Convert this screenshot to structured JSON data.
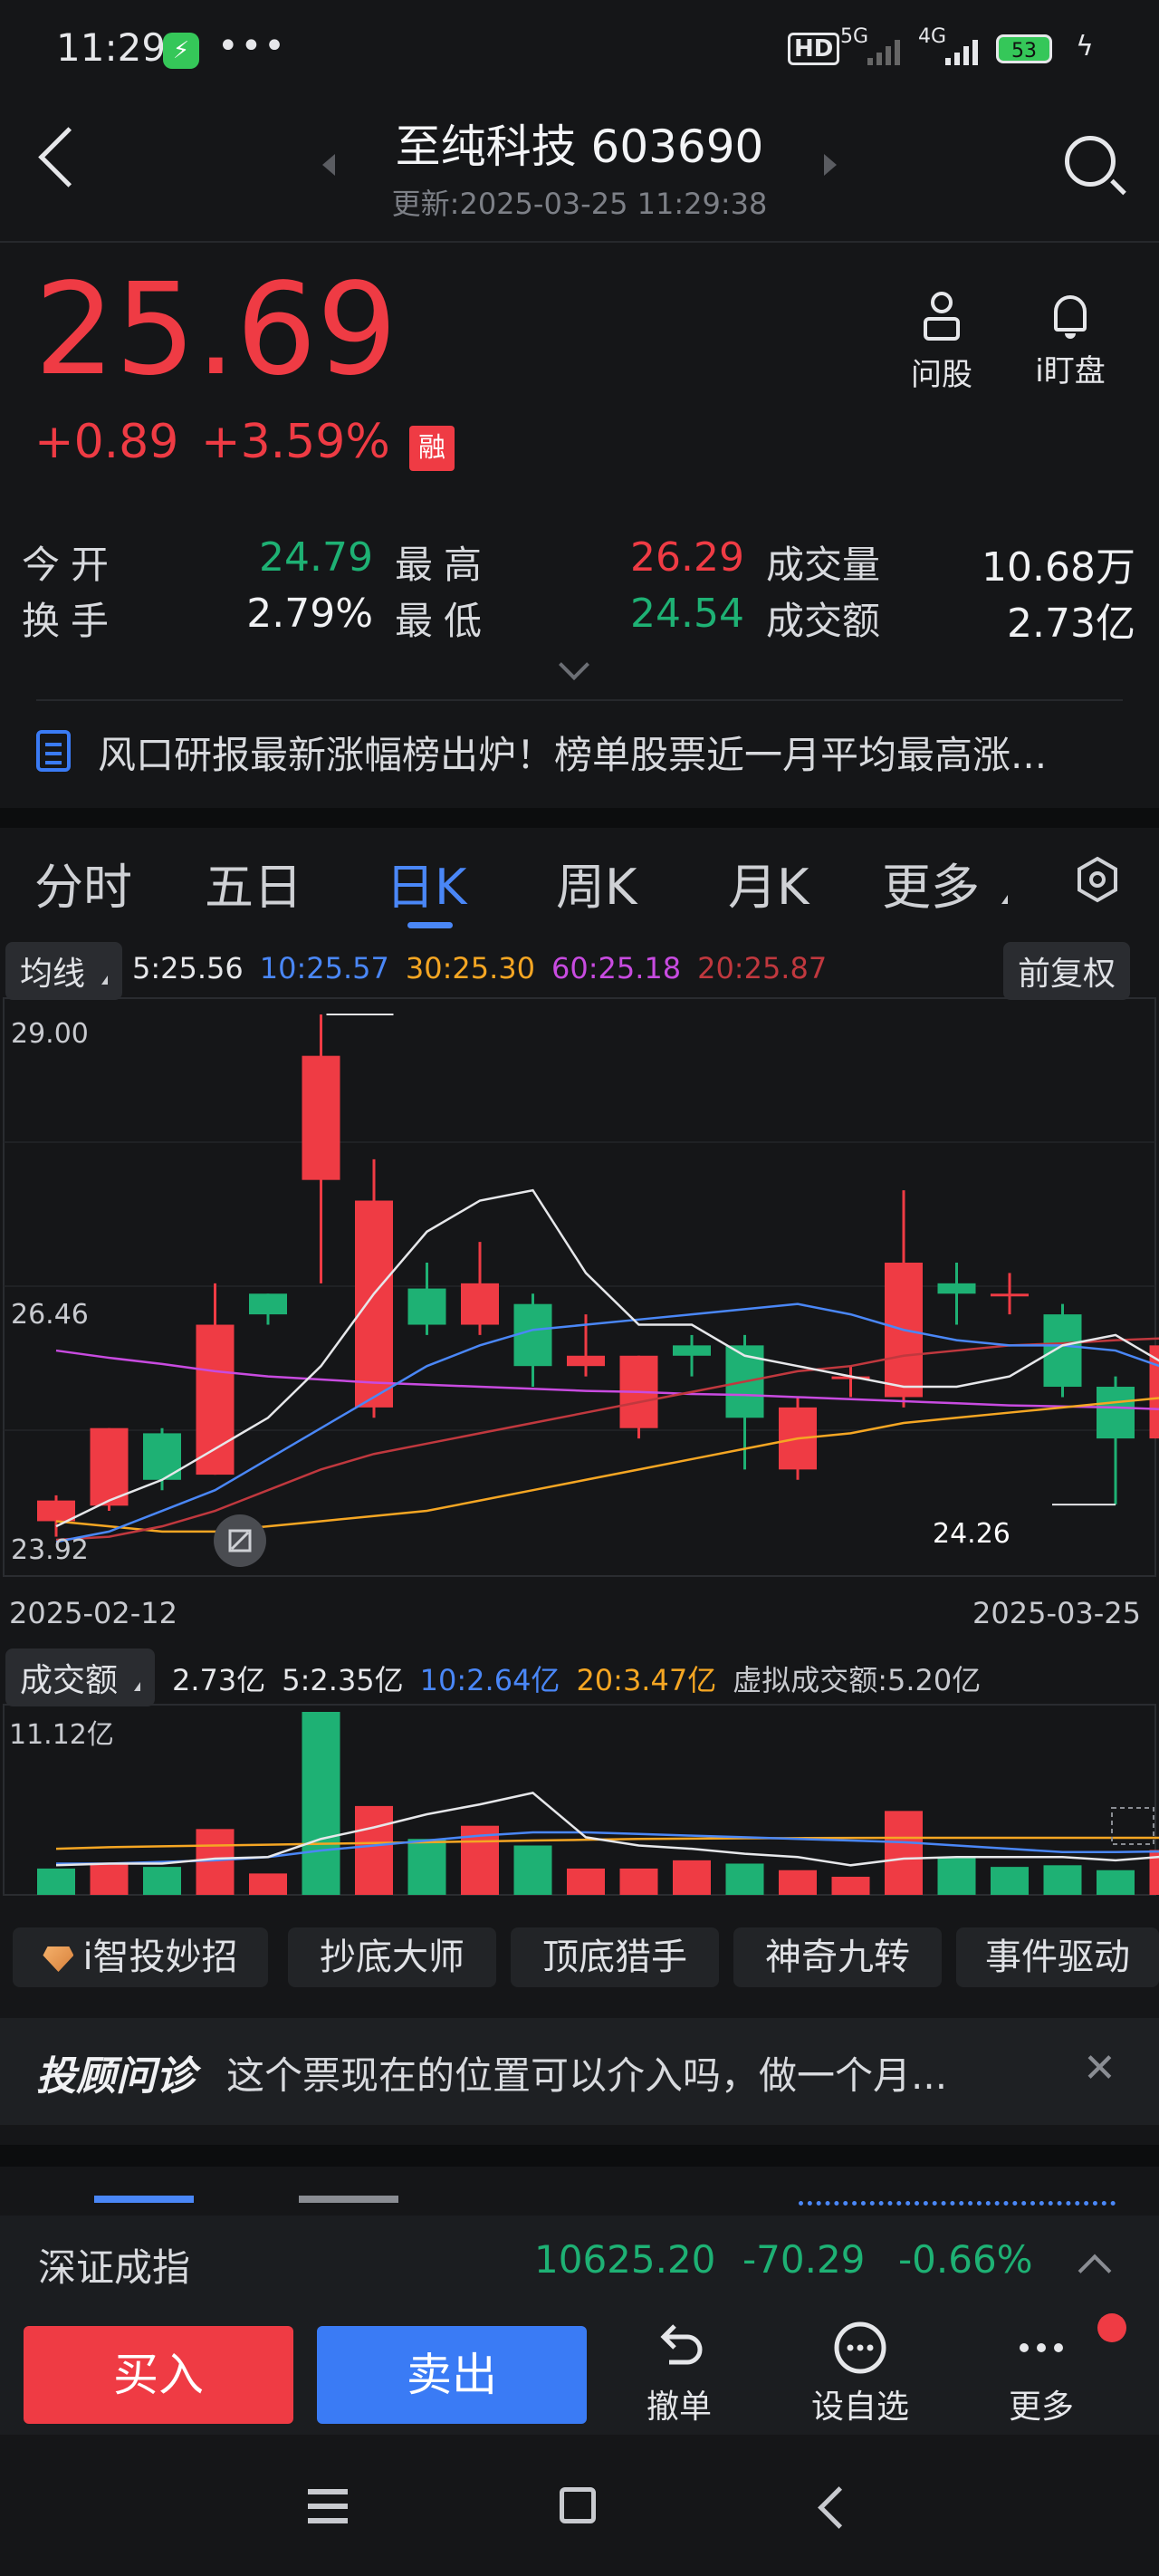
{
  "status_bar": {
    "time": "11:29",
    "net1": "HD",
    "net2": "5G",
    "net3": "4G",
    "battery": "53",
    "battery_level": 0.53
  },
  "header": {
    "title": "至纯科技 603690",
    "subtitle": "更新:2025-03-25 11:29:38"
  },
  "quote": {
    "price": "25.69",
    "change": "+0.89",
    "change_pct": "+3.59%",
    "badge": "融",
    "actions": [
      {
        "label": "问股",
        "icon": "person-icon"
      },
      {
        "label": "i盯盘",
        "icon": "bell-icon"
      }
    ],
    "stats": {
      "open_label": "今开",
      "open": "24.79",
      "high_label": "最高",
      "high": "26.29",
      "volume_label": "成交量",
      "volume": "10.68万",
      "turnover_label": "换手",
      "turnover": "2.79%",
      "low_label": "最低",
      "low": "24.54",
      "amount_label": "成交额",
      "amount": "2.73亿"
    }
  },
  "news": "风口研报最新涨幅榜出炉！榜单股票近一月平均最高涨...",
  "tabs": [
    "分时",
    "五日",
    "日K",
    "周K",
    "月K",
    "更多"
  ],
  "active_tab": "日K",
  "ma_bar": {
    "chip": "均线",
    "items": [
      {
        "label": "5:25.56",
        "color": "#e6e7ea"
      },
      {
        "label": "10:25.57",
        "color": "#4a87f7"
      },
      {
        "label": "30:25.30",
        "color": "#f5a623"
      },
      {
        "label": "60:25.18",
        "color": "#c84be0"
      },
      {
        "label": "20:25.87",
        "color": "#c0383e"
      }
    ],
    "adjust": "前复权"
  },
  "colors": {
    "up": "#ef3b44",
    "down": "#1eb174",
    "ma5": "#e6e7ea",
    "ma10": "#4a87f7",
    "ma20": "#c0383e",
    "ma30": "#f5a623",
    "ma60": "#c84be0"
  },
  "chart_data": [
    {
      "type": "candlestick",
      "y_labels": [
        "29.00",
        "26.46",
        "23.92"
      ],
      "ylim": [
        23.92,
        29.0
      ],
      "x_labels": [
        "2025-02-12",
        "2025-03-25"
      ],
      "annotations": [
        "24.26"
      ],
      "candles": [
        {
          "o": 24.1,
          "c": 24.3,
          "h": 24.35,
          "l": 23.95
        },
        {
          "o": 24.25,
          "c": 25.0,
          "h": 25.0,
          "l": 24.2
        },
        {
          "o": 24.95,
          "c": 24.5,
          "h": 25.0,
          "l": 24.4
        },
        {
          "o": 24.55,
          "c": 26.0,
          "h": 26.4,
          "l": 24.55
        },
        {
          "o": 26.3,
          "c": 26.1,
          "h": 26.3,
          "l": 26.0
        },
        {
          "o": 27.4,
          "c": 28.6,
          "h": 29.0,
          "l": 26.4
        },
        {
          "o": 25.2,
          "c": 27.2,
          "h": 27.6,
          "l": 25.1
        },
        {
          "o": 26.35,
          "c": 26.0,
          "h": 26.6,
          "l": 25.9
        },
        {
          "o": 26.0,
          "c": 26.4,
          "h": 26.8,
          "l": 25.9
        },
        {
          "o": 26.2,
          "c": 25.6,
          "h": 26.3,
          "l": 25.4
        },
        {
          "o": 25.6,
          "c": 25.7,
          "h": 26.1,
          "l": 25.5
        },
        {
          "o": 25.0,
          "c": 25.7,
          "h": 25.7,
          "l": 24.9
        },
        {
          "o": 25.8,
          "c": 25.7,
          "h": 25.9,
          "l": 25.5
        },
        {
          "o": 25.8,
          "c": 25.1,
          "h": 25.9,
          "l": 24.6
        },
        {
          "o": 24.6,
          "c": 25.2,
          "h": 25.3,
          "l": 24.5
        },
        {
          "o": 25.5,
          "c": 25.5,
          "h": 25.6,
          "l": 25.3
        },
        {
          "o": 25.3,
          "c": 26.6,
          "h": 27.3,
          "l": 25.2
        },
        {
          "o": 26.4,
          "c": 26.3,
          "h": 26.6,
          "l": 26.0
        },
        {
          "o": 26.3,
          "c": 26.3,
          "h": 26.5,
          "l": 26.1
        },
        {
          "o": 26.1,
          "c": 25.4,
          "h": 26.2,
          "l": 25.3
        },
        {
          "o": 25.4,
          "c": 24.9,
          "h": 25.5,
          "l": 24.26
        },
        {
          "o": 24.9,
          "c": 25.8,
          "h": 26.3,
          "l": 24.7
        }
      ],
      "ma5": [
        24.05,
        24.3,
        24.5,
        24.8,
        25.1,
        25.6,
        26.3,
        26.9,
        27.2,
        27.3,
        26.5,
        26.0,
        26.0,
        25.7,
        25.6,
        25.5,
        25.4,
        25.4,
        25.5,
        25.8,
        25.9,
        25.6
      ],
      "ma10": [
        23.9,
        24.0,
        24.2,
        24.4,
        24.7,
        25.0,
        25.3,
        25.6,
        25.8,
        25.95,
        26.0,
        26.05,
        26.1,
        26.15,
        26.2,
        26.1,
        25.95,
        25.85,
        25.8,
        25.8,
        25.75,
        25.57
      ],
      "ma20": [
        23.92,
        23.95,
        24.05,
        24.2,
        24.4,
        24.6,
        24.75,
        24.85,
        24.95,
        25.05,
        25.15,
        25.25,
        25.35,
        25.45,
        25.55,
        25.6,
        25.7,
        25.75,
        25.8,
        25.82,
        25.85,
        25.87
      ],
      "ma30": [
        24.1,
        24.05,
        24.0,
        24.0,
        24.05,
        24.1,
        24.15,
        24.2,
        24.3,
        24.4,
        24.5,
        24.6,
        24.7,
        24.8,
        24.9,
        24.95,
        25.05,
        25.1,
        25.15,
        25.2,
        25.25,
        25.3
      ],
      "ma60": [
        25.75,
        25.68,
        25.62,
        25.55,
        25.5,
        25.47,
        25.44,
        25.42,
        25.4,
        25.38,
        25.36,
        25.35,
        25.33,
        25.32,
        25.3,
        25.28,
        25.26,
        25.24,
        25.22,
        25.21,
        25.2,
        25.18
      ]
    },
    {
      "type": "bar",
      "title": "成交额",
      "y_labels": [
        "11.12亿"
      ],
      "ylim": [
        0,
        11.12
      ],
      "items": [
        {
          "label": "2.73亿",
          "color": "#e6e7ea"
        },
        {
          "label": "5:2.35亿",
          "color": "#e6e7ea"
        },
        {
          "label": "10:2.64亿",
          "color": "#4a87f7"
        },
        {
          "label": "20:3.47亿",
          "color": "#f5a623"
        },
        {
          "label": "虚拟成交额:5.20亿",
          "color": "#c8cacf"
        }
      ],
      "values": [
        1.6,
        1.9,
        1.7,
        4.0,
        1.3,
        11.12,
        5.4,
        3.4,
        4.2,
        3.0,
        1.6,
        1.6,
        2.1,
        1.9,
        1.5,
        1.1,
        5.1,
        2.3,
        1.7,
        1.8,
        1.5,
        2.73
      ],
      "up": [
        false,
        true,
        false,
        true,
        true,
        false,
        true,
        false,
        true,
        false,
        true,
        true,
        true,
        false,
        true,
        true,
        true,
        false,
        false,
        false,
        false,
        true
      ],
      "ma5": [
        1.8,
        1.9,
        1.9,
        2.2,
        2.3,
        3.4,
        4.1,
        4.9,
        5.5,
        6.2,
        3.5,
        3.0,
        2.8,
        2.5,
        2.3,
        1.8,
        2.2,
        2.3,
        2.3,
        2.3,
        2.1,
        2.35
      ],
      "ma10": [
        1.9,
        1.9,
        2.0,
        2.1,
        2.3,
        2.7,
        3.0,
        3.3,
        3.6,
        3.8,
        3.8,
        3.7,
        3.6,
        3.5,
        3.4,
        3.3,
        3.2,
        3.0,
        2.8,
        2.6,
        2.6,
        2.64
      ],
      "ma20": [
        2.8,
        2.9,
        2.95,
        3.0,
        3.05,
        3.1,
        3.15,
        3.2,
        3.25,
        3.3,
        3.35,
        3.4,
        3.42,
        3.44,
        3.45,
        3.46,
        3.47,
        3.47,
        3.47,
        3.47,
        3.47,
        3.47
      ]
    }
  ],
  "tools": [
    {
      "label": "i智投妙招",
      "icon": "gem-icon"
    },
    {
      "label": "抄底大师"
    },
    {
      "label": "顶底猎手"
    },
    {
      "label": "神奇九转"
    },
    {
      "label": "事件驱动"
    }
  ],
  "advisor": {
    "brand": "投顾问诊",
    "text": "这个票现在的位置可以介入吗，做一个月..."
  },
  "index_bar": {
    "name": "深证成指",
    "value": "10625.20",
    "change": "-70.29",
    "change_pct": "-0.66%"
  },
  "bottom_actions": {
    "buy": "买入",
    "sell": "卖出",
    "items": [
      {
        "label": "撤单",
        "icon": "undo-icon"
      },
      {
        "label": "设自选",
        "icon": "more-circle-icon"
      },
      {
        "label": "更多",
        "icon": "more-icon"
      }
    ]
  }
}
